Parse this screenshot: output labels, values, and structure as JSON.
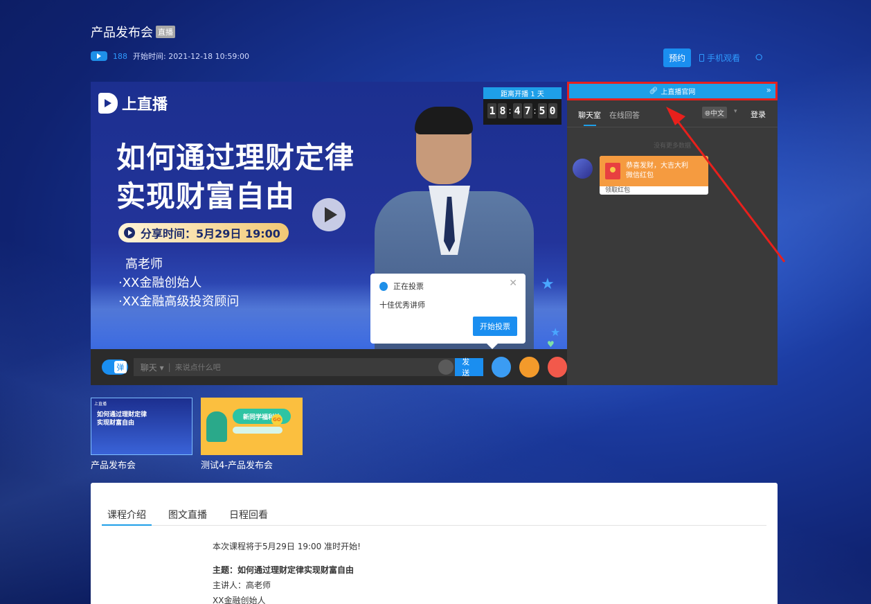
{
  "header": {
    "title": "产品发布会",
    "live_tag": "直播",
    "views": "188",
    "start_time": "开始时间: 2021-12-18 10:59:00",
    "reserve_label": "预约",
    "mobile_watch_label": "手机观看"
  },
  "player": {
    "poster": {
      "logo_text": "上直播",
      "headline_1": "如何通过理财定律",
      "headline_2": "实现财富自由",
      "share_time": "分享时间：5月29日 19:00",
      "teacher_name": "高老师",
      "teacher_line_1": "·XX金融创始人",
      "teacher_line_2": "·XX金融高级投资顾问"
    },
    "countdown": {
      "label": "距离开播 1 天",
      "digits": [
        "1",
        "8",
        "4",
        "7",
        "5",
        "0"
      ]
    },
    "vote_popup": {
      "title": "正在投票",
      "item": "十佳优秀讲师",
      "button": "开始投票"
    },
    "control_bar": {
      "danmu_label": "弹",
      "chat_mode": "聊天",
      "chat_placeholder": "来说点什么吧",
      "send_label": "发送"
    }
  },
  "side_panel": {
    "official_link": "上直播官网",
    "tabs": [
      "聊天室",
      "在线回答"
    ],
    "language": "中文",
    "login": "登录",
    "no_more": "没有更多数据",
    "red_packet": {
      "line_1": "恭喜发财，大吉大利",
      "line_2": "微信红包",
      "footer": "领取红包"
    }
  },
  "thumbnails": [
    {
      "label": "产品发布会",
      "img_title_1": "如何通过理财定律",
      "img_title_2": "实现财富自由",
      "img_logo": "上直播"
    },
    {
      "label": "测试4-产品发布会",
      "img_banner": "新同学福利站",
      "img_go": "GO"
    }
  ],
  "content": {
    "tabs": [
      "课程介绍",
      "图文直播",
      "日程回看"
    ],
    "intro": "本次课程将于5月29日 19:00 准时开始!",
    "topic": "主题：如何通过理财定律实现财富自由",
    "speaker": "主讲人：高老师",
    "speaker_title": "XX金融创始人"
  },
  "colors": {
    "accent": "#1a8ef0",
    "highlight_border": "#e8201c",
    "red_packet": "#f59b40"
  }
}
